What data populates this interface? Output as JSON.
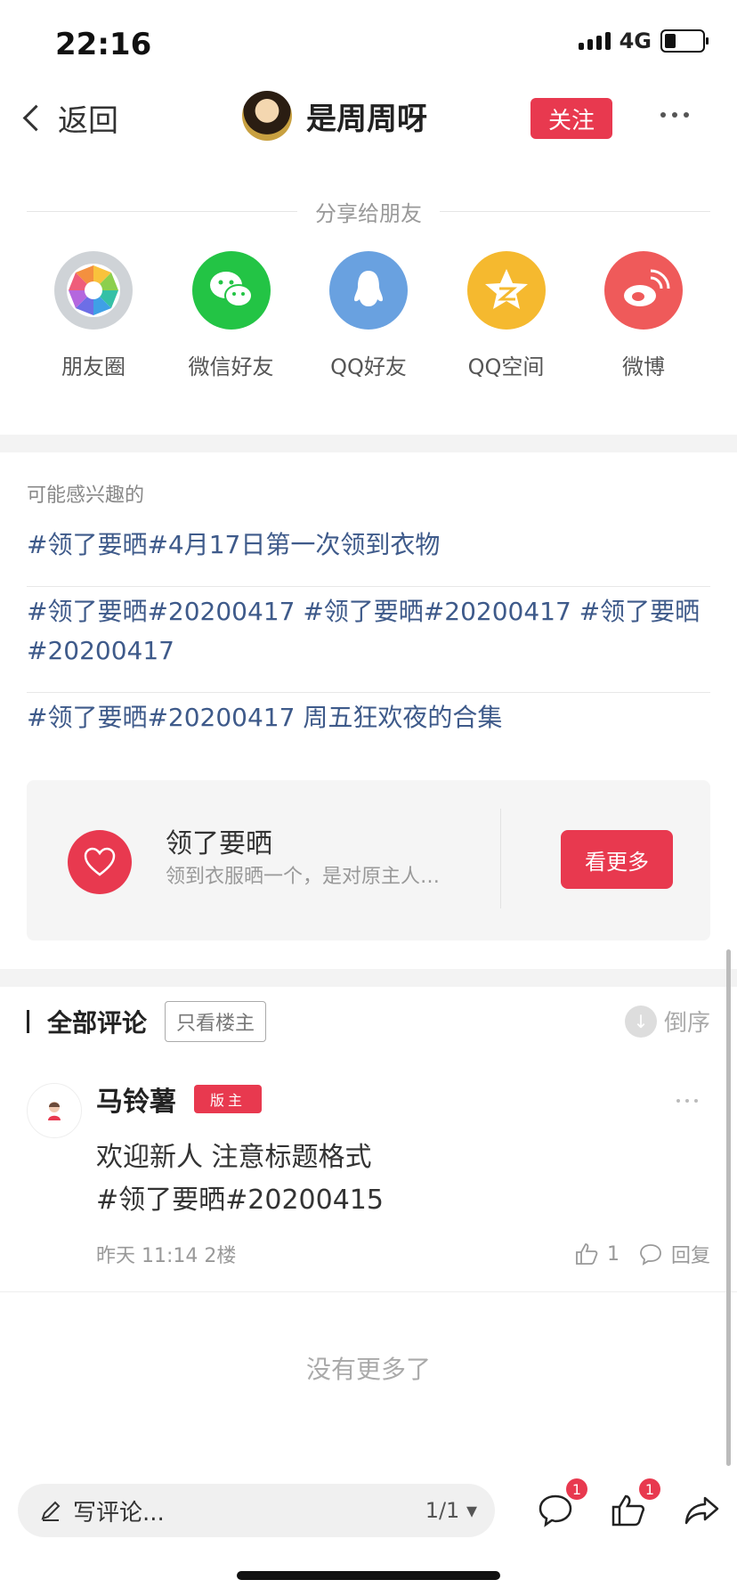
{
  "status": {
    "time": "22:16",
    "network": "4G"
  },
  "header": {
    "back_label": "返回",
    "author": "是周周呀",
    "follow_label": "关注"
  },
  "share": {
    "title": "分享给朋友",
    "items": [
      {
        "label": "朋友圈",
        "icon": "moments-icon",
        "color": "#cfd3d7"
      },
      {
        "label": "微信好友",
        "icon": "wechat-icon",
        "color": "#23c445"
      },
      {
        "label": "QQ好友",
        "icon": "qq-icon",
        "color": "#69a1e0"
      },
      {
        "label": "QQ空间",
        "icon": "qzone-icon",
        "color": "#f5b92f"
      },
      {
        "label": "微博",
        "icon": "weibo-icon",
        "color": "#ef5a5a"
      }
    ]
  },
  "interest": {
    "title": "可能感兴趣的",
    "topics": [
      "#领了要晒#4月17日第一次领到衣物",
      "#领了要晒#20200417 #领了要晒#20200417 #领了要晒#20200417",
      "#领了要晒#20200417 周五狂欢夜的合集"
    ]
  },
  "circle_card": {
    "title": "领了要晒",
    "desc": "领到衣服晒一个，是对原主人…",
    "button": "看更多"
  },
  "comments": {
    "title": "全部评论",
    "only_owner": "只看楼主",
    "sort_label": "倒序",
    "items": [
      {
        "name": "马铃薯",
        "badge": "版主",
        "line1": "欢迎新人 注意标题格式",
        "line2": "#领了要晒#20200415",
        "time": "昨天 11:14",
        "floor": "2楼",
        "likes": "1",
        "reply": "回复"
      }
    ],
    "end_text": "没有更多了"
  },
  "bottom_bar": {
    "placeholder": "写评论...",
    "page": "1/1",
    "comment_badge": "1",
    "like_badge": "1"
  },
  "colors": {
    "accent": "#e8394f",
    "link": "#3e5a8a"
  }
}
